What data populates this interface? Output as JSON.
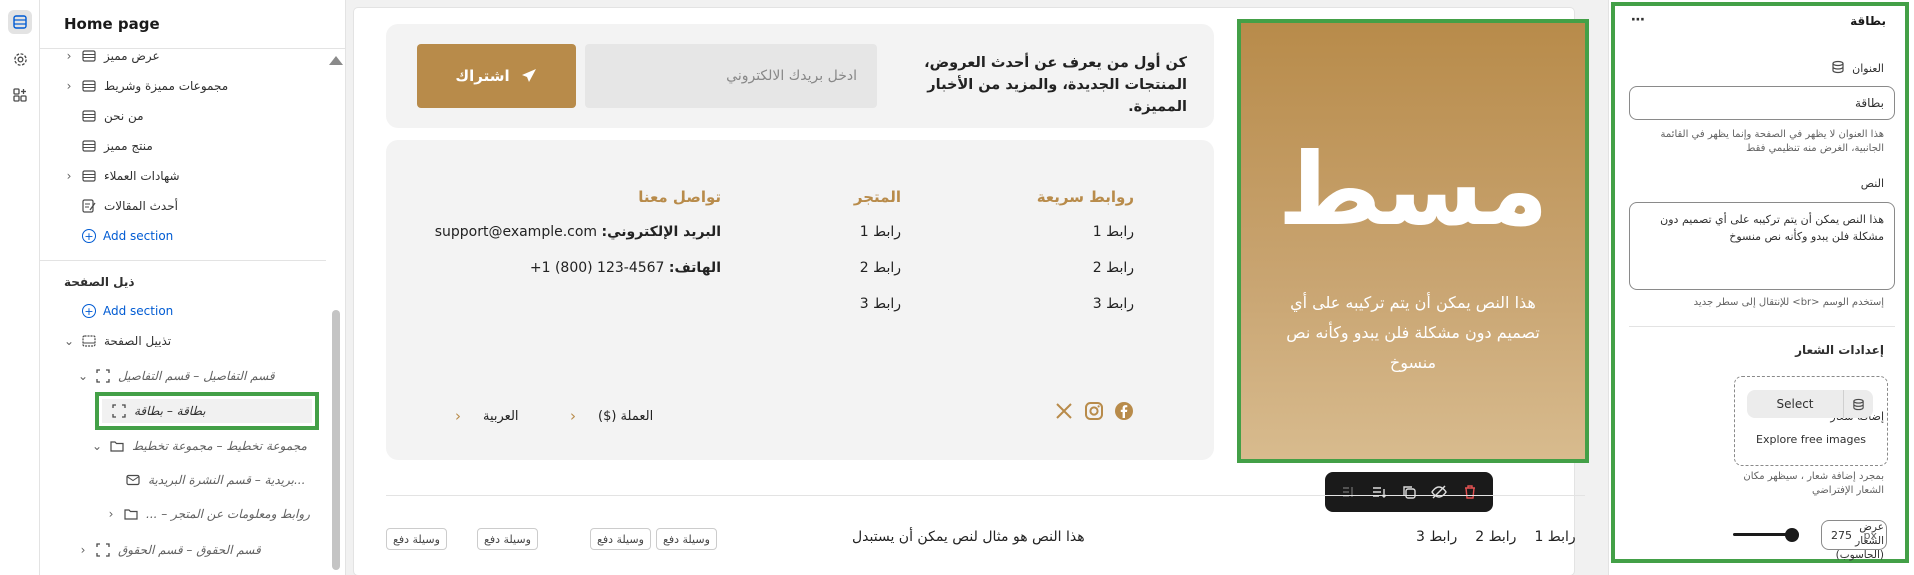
{
  "left_panel": {
    "title": "Home page",
    "items": [
      {
        "label": "عرض مميز"
      },
      {
        "label": "مجموعات مميزة وشريط"
      },
      {
        "label": "من نحن"
      },
      {
        "label": "منتج مميز"
      },
      {
        "label": "شهادات العملاء"
      },
      {
        "label": "أحدث المقالات"
      }
    ],
    "add_section": "Add section",
    "footer_group": "ذيل الصفحة",
    "footer_add_section": "Add section",
    "footer_item": "تذييل الصفحة",
    "details_section": "قسم التفاصيل – قسم التفاصيل",
    "card_item": "بطاقة – بطاقة",
    "layout_group": "مجموعة تخطيط – مجموعة تخطيط",
    "newsletter_item": "بريدية – قسم النشرة البريدية...",
    "links_item": "... – روابط ومعلومات عن المتجر",
    "rights_item": "قسم الحقوق – قسم الحقوق"
  },
  "newsletter": {
    "line1": "كن أول من يعرف عن أحدث العروض،",
    "line2": "المنتجات الجديدة، والمزيد من الأخبار المميزة.",
    "placeholder": "ادخل بريدك الالكتروني",
    "button": "اشتراك"
  },
  "footer": {
    "quick_links": {
      "title": "روابط سريعة",
      "links": [
        "رابط 1",
        "رابط 2",
        "رابط 3"
      ]
    },
    "store": {
      "title": "المتجر",
      "links": [
        "رابط 1",
        "رابط 2",
        "رابط 3"
      ]
    },
    "contact": {
      "title": "تواصل معنا",
      "email_label": "البريد الإلكتروني:",
      "email": "support@example.com",
      "phone_label": "الهاتف:",
      "phone": "+1 (800) 123-4567"
    },
    "currency": "العملة ($)",
    "language": "العربية"
  },
  "card": {
    "logo": "مسط",
    "text": "هذا النص يمكن أن يتم تركيبه على أي تصميم دون مشكلة فلن يبدو وكأنه نص منسوخ"
  },
  "bottom_bar": {
    "links": [
      "رابط 1",
      "رابط 2",
      "رابط 3"
    ],
    "text": "هذا النص هو مثال لنص يمكن أن يستبدل",
    "payments": [
      "وسيلة دفع",
      "وسيلة دفع",
      "وسيلة دفع",
      "وسيلة دفع"
    ]
  },
  "right_panel": {
    "title": "بطاقة",
    "title_label": "العنوان",
    "title_value": "بطاقة",
    "title_help": "هذا العنوان لا يظهر في الصفحة وإنما يظهر في القائمة الجانبية، الغرض منه تنظيمي فقط",
    "text_label": "النص",
    "text_value": "هذا النص يمكن أن يتم تركيبه على أي تصميم دون مشكلة فلن يبدو وكأنه نص منسوخ",
    "text_help": "إستخدم الوسم <br> للإنتقال إلى سطر جديد",
    "logo_settings": "إعدادات الشعار",
    "add_logo": "إضافة شعار",
    "select": "Select",
    "explore": "Explore free images",
    "logo_help": "بمجرد إضافة شعار ، سيظهر مكان الشعار الإفتراضي",
    "logo_width_label": "عرض الشعار (الحاسوب)",
    "logo_width_value": "275",
    "logo_width_unit": "px",
    "logo_width_fraction": 0.9
  },
  "colors": {
    "accent": "#b88b4a",
    "highlight": "#43a047",
    "link": "#005bd3"
  }
}
